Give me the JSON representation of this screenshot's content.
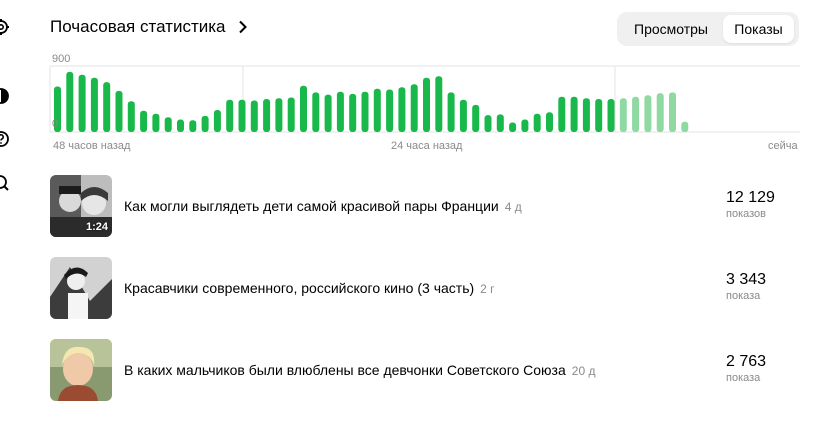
{
  "header": {
    "title": "Почасовая статистика",
    "toggle": {
      "views_label": "Просмотры",
      "shows_label": "Показы",
      "active": "shows"
    }
  },
  "chart_data": {
    "type": "bar",
    "title": "",
    "ylim": [
      0,
      900
    ],
    "y_ticks": [
      "900",
      "0"
    ],
    "x_labels": [
      "48 часов назад",
      "24 часа назад",
      "сейча"
    ],
    "colors": {
      "main": "#19b84a",
      "recent": "#8fd9a3"
    },
    "values": [
      620,
      820,
      780,
      740,
      680,
      560,
      420,
      290,
      250,
      200,
      170,
      160,
      220,
      300,
      440,
      440,
      430,
      450,
      460,
      470,
      630,
      540,
      510,
      550,
      520,
      550,
      590,
      580,
      610,
      650,
      740,
      760,
      540,
      440,
      370,
      230,
      240,
      130,
      170,
      250,
      270,
      480,
      480,
      460,
      450,
      450,
      460,
      480,
      500,
      530,
      540,
      140,
      0
    ],
    "recent_from_index": 46
  },
  "items": [
    {
      "title": "Как могли выглядеть дети самой красивой пары Франции",
      "age": "4 д",
      "value": "12 129",
      "unit": "показов",
      "duration": "1:24"
    },
    {
      "title": "Красавчики современного, российского кино (3 часть)",
      "age": "2 г",
      "value": "3 343",
      "unit": "показа",
      "duration": ""
    },
    {
      "title": "В каких мальчиков были влюблены все девчонки Советского Союза",
      "age": "20 д",
      "value": "2 763",
      "unit": "показа",
      "duration": ""
    }
  ]
}
